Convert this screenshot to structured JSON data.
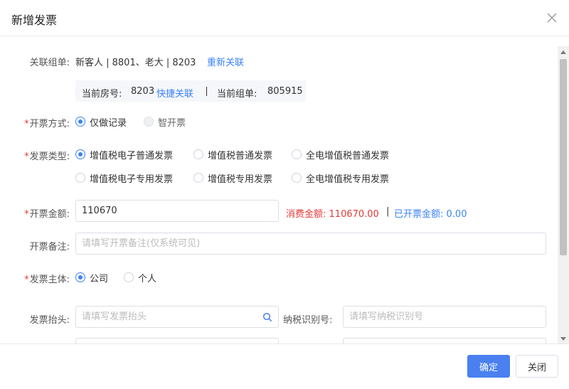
{
  "dialog": {
    "title": "新增发票"
  },
  "form": {
    "link_order": {
      "label": "关联组单:",
      "value": "新客人 | 8801、老大 | 8203",
      "relink": "重新关联",
      "current_room_label": "当前房号:",
      "current_room": "8203",
      "quick_link": "快捷关联",
      "current_order_label": "当前组单:",
      "current_order": "805915"
    },
    "method": {
      "label": "开票方式:",
      "options": [
        "仅做记录",
        "智开票"
      ],
      "selected": "仅做记录"
    },
    "invoice_type": {
      "label": "发票类型:",
      "options": [
        "增值税电子普通发票",
        "增值税普通发票",
        "全电增值税普通发票",
        "增值税电子专用发票",
        "增值税专用发票",
        "全电增值税专用发票"
      ],
      "selected": "增值税电子普通发票"
    },
    "amount": {
      "label": "开票金额:",
      "value": "110670",
      "consumed_label": "消费金额:",
      "consumed": "110670.00",
      "divider": "|",
      "invoiced_label": "已开票金额:",
      "invoiced": "0.00"
    },
    "remark": {
      "label": "开票备注:",
      "placeholder": "请填写开票备注(仅系统可见)"
    },
    "subject": {
      "label": "发票主体:",
      "options": [
        "公司",
        "个人"
      ],
      "selected": "公司"
    },
    "header": {
      "label": "发票抬头:",
      "placeholder": "请填写发票抬头"
    },
    "tax_id": {
      "label": "纳税识别号:",
      "placeholder": "请填写纳税识别号"
    }
  },
  "footer": {
    "confirm": "确定",
    "close": "关闭"
  },
  "colors": {
    "primary": "#4a80f0",
    "required": "#e53935",
    "link": "#3b82f6",
    "consumed": "#e53935"
  },
  "icons": {
    "close": "close-icon",
    "search": "search-icon"
  }
}
